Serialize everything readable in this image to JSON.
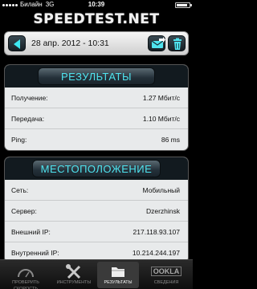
{
  "status_bar": {
    "carrier": "Билайн",
    "network": "3G",
    "time": "10:39",
    "battery_level": 0.85
  },
  "app": {
    "logo": "SPEEDTEST.NET"
  },
  "date_bar": {
    "datetime": "28 апр. 2012 - 10:31"
  },
  "results": {
    "title": "РЕЗУЛЬТАТЫ",
    "rows": [
      {
        "label": "Получение:",
        "value": "1.27 Мбит/с"
      },
      {
        "label": "Передача:",
        "value": "1.10 Мбит/с"
      },
      {
        "label": "Ping:",
        "value": "86 ms"
      }
    ]
  },
  "location": {
    "title": "МЕСТОПОЛОЖЕНИЕ",
    "rows": [
      {
        "label": "Сеть:",
        "value": "Мобильный"
      },
      {
        "label": "Сервер:",
        "value": "Dzerzhinsk"
      },
      {
        "label": "Внешний IP:",
        "value": "217.118.93.107"
      },
      {
        "label": "Внутренний IP:",
        "value": "10.214.244.197"
      }
    ]
  },
  "tabs": [
    {
      "label": "ПРОВЕРИТЬ СКОРОСТЬ",
      "icon": "speedometer-icon",
      "active": false
    },
    {
      "label": "ИНСТРУМЕНТЫ",
      "icon": "tools-icon",
      "active": false
    },
    {
      "label": "РЕЗУЛЬТАТЫ",
      "icon": "folder-icon",
      "active": true
    },
    {
      "label": "СВЕДЕНИЯ",
      "icon": "ookla-logo-icon",
      "active": false
    }
  ],
  "tab_logo": "OOKLA",
  "colors": {
    "accent": "#4fe3ee",
    "panel_bg": "#e8eaeb",
    "header_bg": "#121a1f"
  }
}
